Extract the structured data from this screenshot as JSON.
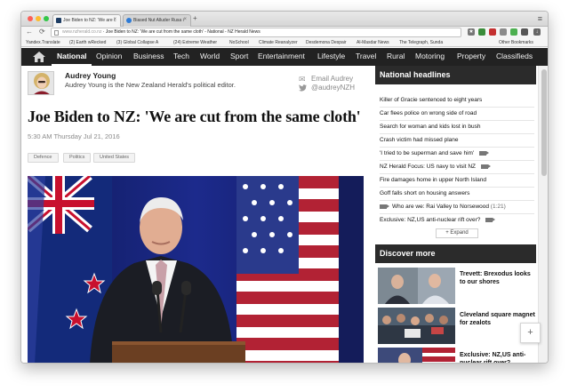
{
  "browser": {
    "tabs": [
      {
        "label": "Joe Biden to NZ: 'We are c",
        "active": true
      },
      {
        "label": "Biased Nut Alluder Rusa i",
        "active": false
      }
    ],
    "new_tab": "+",
    "url_host": "www.nzherald.co.nz",
    "url_title": "Joe Biden to NZ: 'We are cut from the same cloth' - National - NZ Herald News",
    "bookmarks": [
      "Yandex.Translate",
      "(2) Earth wRecked",
      "(3) Global Collapse A",
      "(24) Extreme Weather",
      "NoSchool",
      "Climate Reanalyzer",
      "Desdemona Despair",
      "Al-Masdar News",
      "The Telegraph, Sunda",
      "Other Bookmarks"
    ]
  },
  "site_nav": {
    "items": [
      "National",
      "Opinion",
      "Business",
      "Tech",
      "World",
      "Sport",
      "Entertainment",
      "Lifestyle",
      "Travel",
      "Rural",
      "Motoring",
      "Property",
      "Classifieds"
    ],
    "active": "National"
  },
  "author": {
    "name": "Audrey Young",
    "bio": "Audrey Young is the New Zealand Herald's political editor.",
    "email_label": "Email Audrey",
    "twitter_handle": "@audreyNZH"
  },
  "article": {
    "headline": "Joe Biden to NZ: 'We are cut from the same cloth'",
    "dateline": "5:30 AM Thursday Jul 21, 2016",
    "tags": [
      "Defence",
      "Politics",
      "United States"
    ]
  },
  "sidebar": {
    "national_headlines_title": "National headlines",
    "headlines": [
      {
        "text": "Killer of Gracie sentenced to eight years",
        "video": ""
      },
      {
        "text": "Car flees police on wrong side of road",
        "video": ""
      },
      {
        "text": "Search for woman and kids lost in bush",
        "video": ""
      },
      {
        "text": "Crash victim had missed plane",
        "video": ""
      },
      {
        "text": "'I tried to be superman and save him'",
        "video": "after"
      },
      {
        "text": "NZ Herald Focus: US navy to visit NZ",
        "video": "after"
      },
      {
        "text": "Fire damages home in upper North Island",
        "video": ""
      },
      {
        "text": "Goff falls short on housing answers",
        "video": ""
      },
      {
        "text": "Who are we: Rai Valley to Norsewood",
        "video": "before",
        "duration": "(1:21)"
      },
      {
        "text": "Exclusive: NZ,US anti-nuclear rift over?",
        "video": "after"
      }
    ],
    "expand_label": "+ Expand",
    "discover_title": "Discover more",
    "discover": [
      {
        "title": "Trevett: Brexodus looks to our shores"
      },
      {
        "title": "Cleveland square magnet for zealots"
      },
      {
        "title": "Exclusive: NZ,US anti-nuclear rift over?"
      }
    ]
  },
  "floating_button": "+"
}
